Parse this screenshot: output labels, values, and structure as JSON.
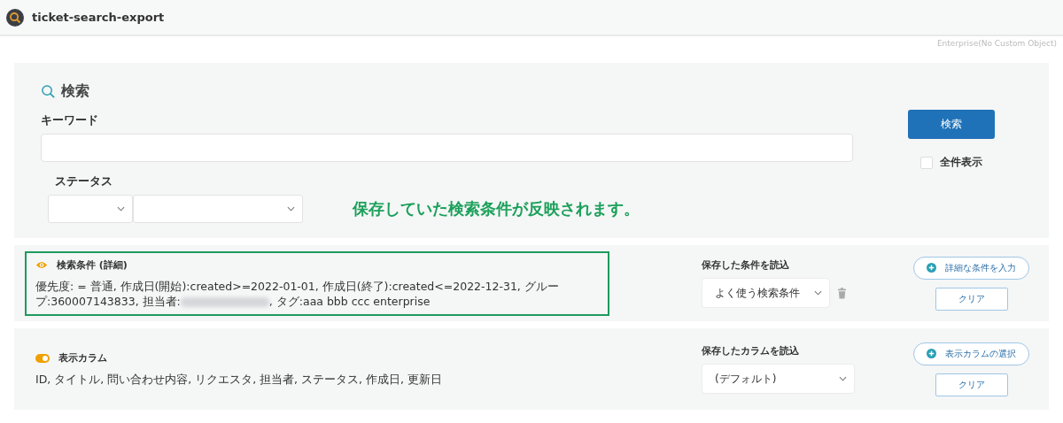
{
  "header": {
    "title": "ticket-search-export"
  },
  "plan_label": "Enterprise(No Custom Object)",
  "search": {
    "title": "検索",
    "keyword_label": "キーワード",
    "status_label": "ステータス",
    "button": "検索",
    "show_all": {
      "label": "全件表示",
      "checked": false
    }
  },
  "annotation": "保存していた検索条件が反映されます。",
  "conditions": {
    "highlighted": true,
    "title": "検索条件 (詳細)",
    "text_before": "優先度: = 普通, 作成日(開始):created>=2022-01-01, 作成日(終了):created<=2022-12-31, グループ:360007143833, 担当者:",
    "redacted": true,
    "text_after": ", タグ:aaa bbb ccc enterprise",
    "saved_label": "保存した条件を読込",
    "saved_value": "よく使う検索条件",
    "add_button": "詳細な条件を入力",
    "clear_button": "クリア"
  },
  "columns": {
    "on": true,
    "title": "表示カラム",
    "text": "ID, タイトル, 問い合わせ内容, リクエスタ, 担当者, ステータス, 作成日, 更新日",
    "saved_label": "保存したカラムを読込",
    "saved_value": "(デフォルト)",
    "add_button": "表示カラムの選択",
    "clear_button": "クリア"
  }
}
